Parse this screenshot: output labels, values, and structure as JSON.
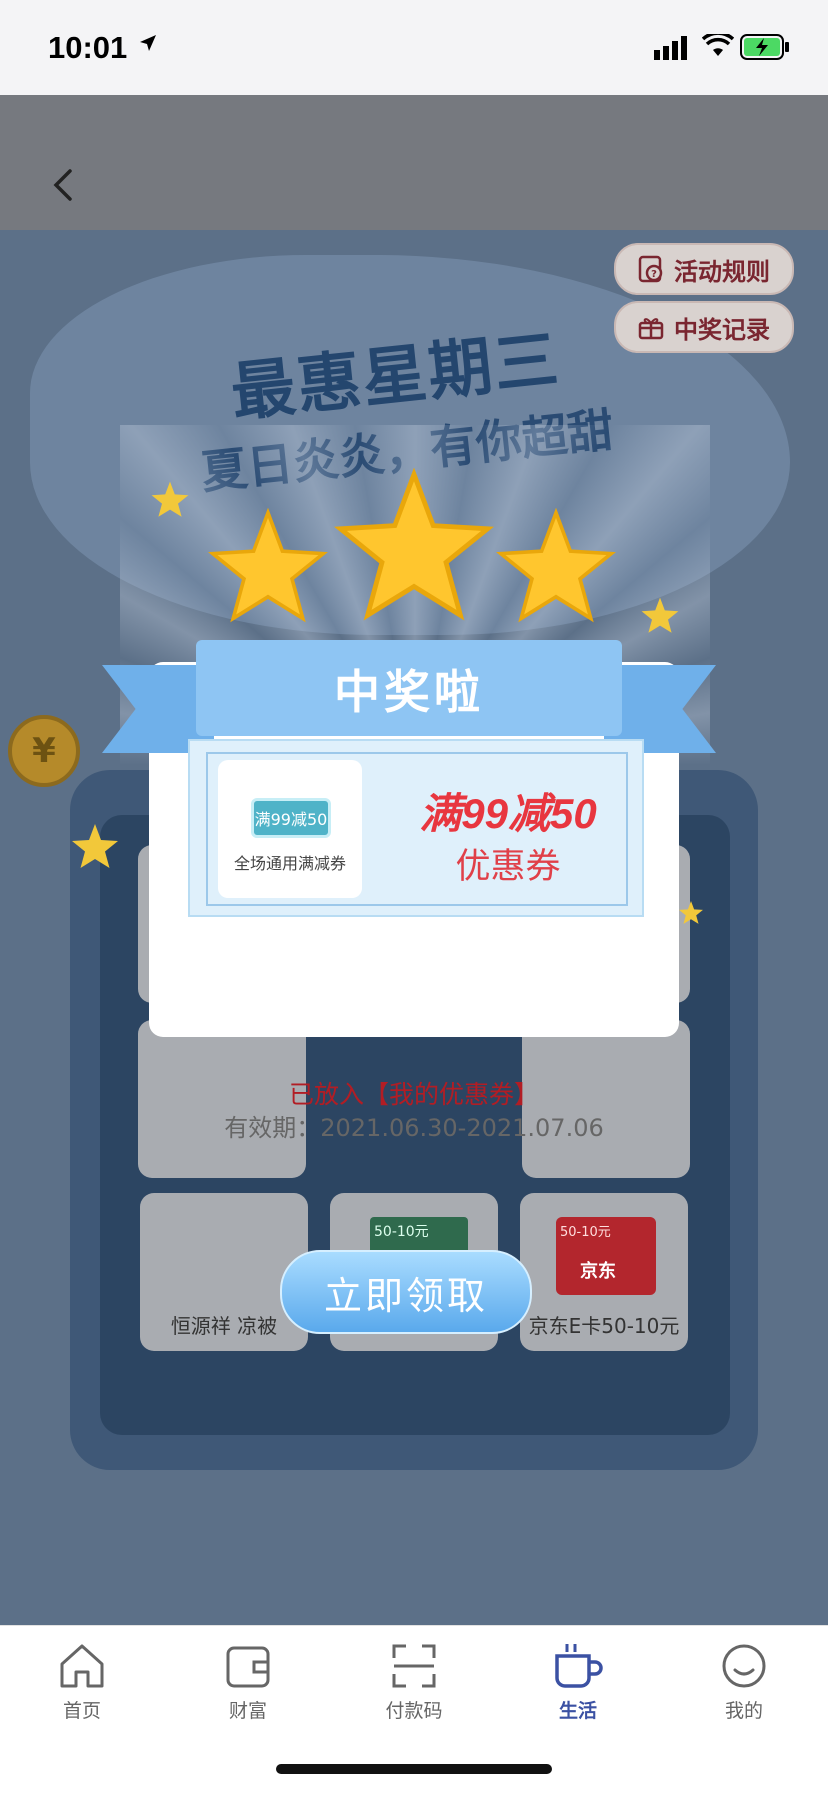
{
  "status_bar": {
    "time": "10:01"
  },
  "banner": {
    "title": "最惠星期三",
    "subtitle": "夏日炎炎，有你超甜",
    "rules_label": "活动规则",
    "records_label": "中奖记录",
    "coin_symbol": "¥"
  },
  "prize_grid": {
    "tiles": [
      {
        "caption": "恒源祥 凉被"
      },
      {
        "tag": "50-10元"
      },
      {
        "tag": "50-10元",
        "brand": "京东",
        "caption": "京东E卡50-10元"
      }
    ]
  },
  "dialog": {
    "header": "中奖啦",
    "coupon": {
      "thumb_label": "满99减50",
      "thumb_scope": "全场通用满减券",
      "amount": "满99减50",
      "type": "优惠券"
    },
    "placed_text": "已放入【我的优惠券】",
    "validity_text": "有效期：2021.06.30-2021.07.06"
  },
  "claim_button": "立即领取",
  "tabs": [
    {
      "label": "首页",
      "icon": "home-icon"
    },
    {
      "label": "财富",
      "icon": "wallet-icon"
    },
    {
      "label": "付款码",
      "icon": "scan-icon"
    },
    {
      "label": "生活",
      "icon": "cup-icon",
      "active": true
    },
    {
      "label": "我的",
      "icon": "profile-icon"
    }
  ],
  "colors": {
    "accent": "#3b51a3",
    "coupon_red": "#e8363f",
    "ribbon": "#8ec5f3"
  }
}
